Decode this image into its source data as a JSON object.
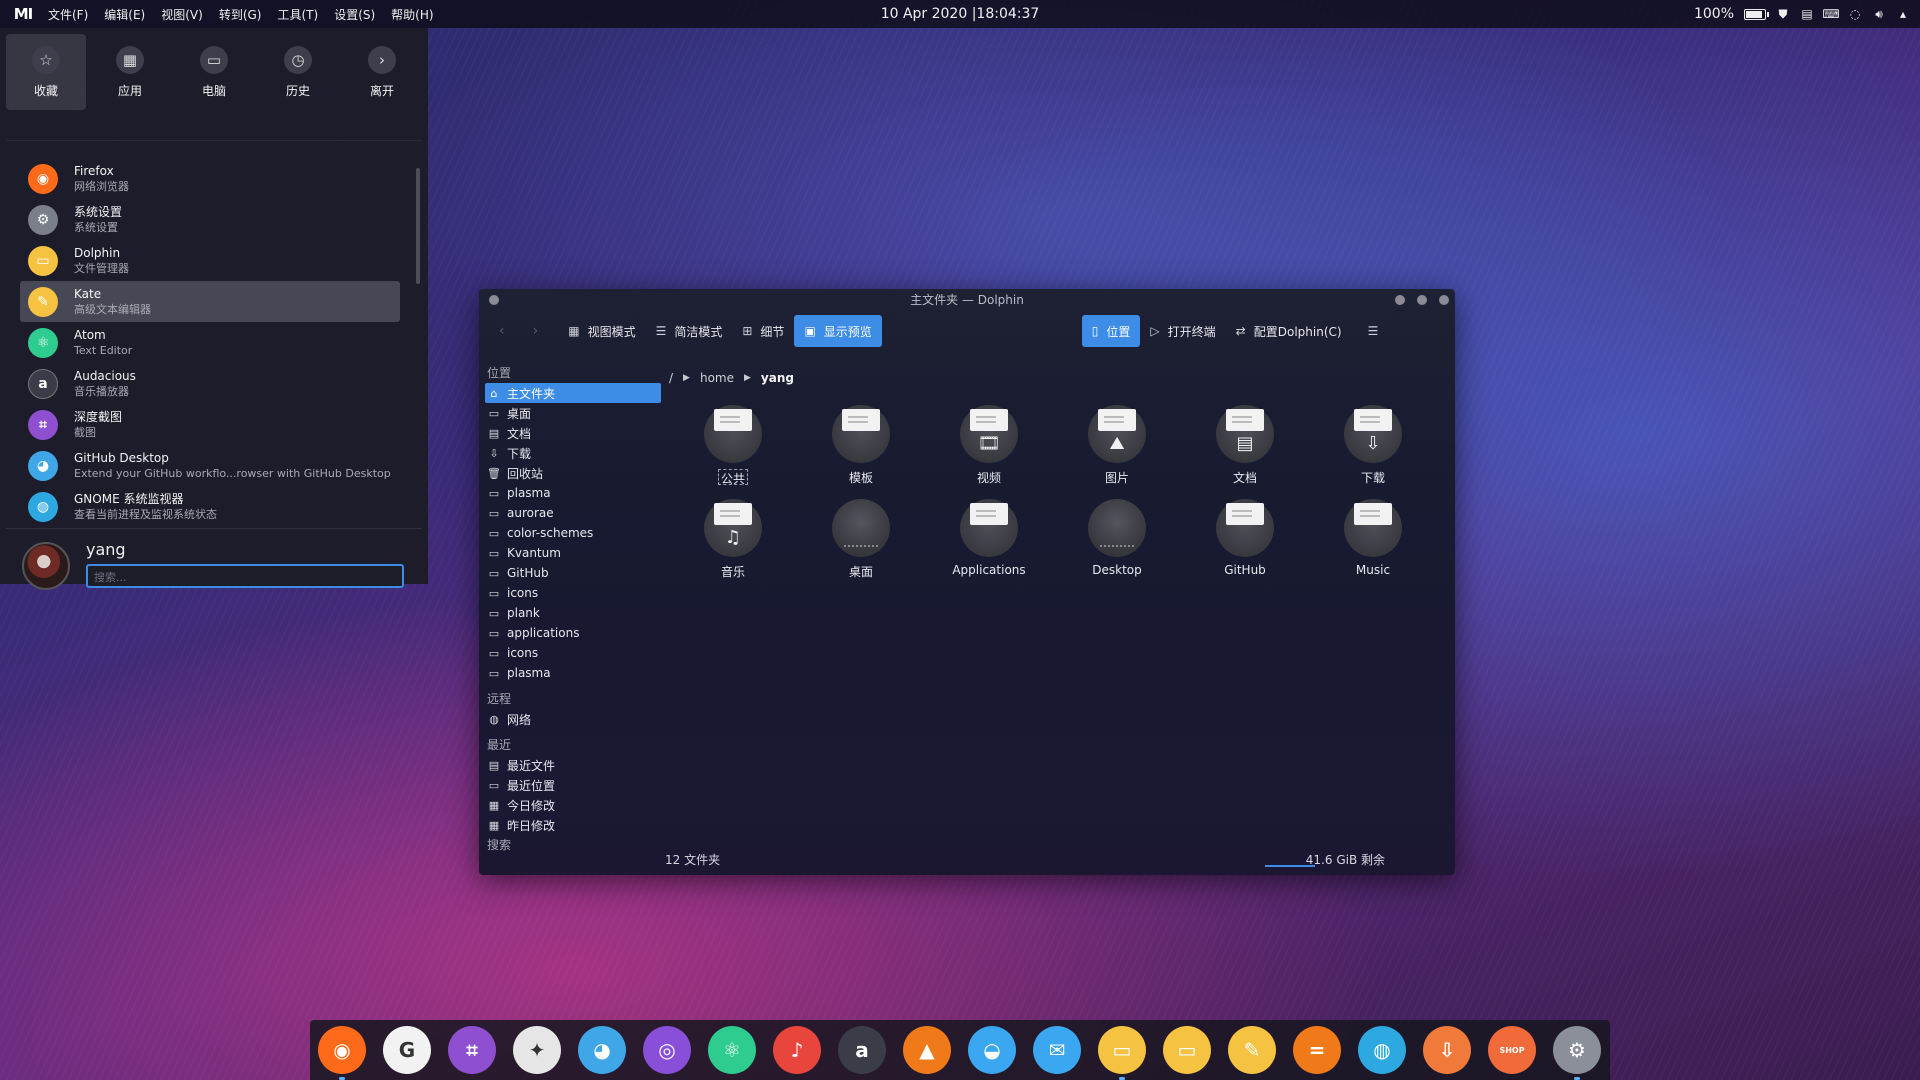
{
  "top_panel": {
    "logo": "MI",
    "menus": [
      "文件(F)",
      "编辑(E)",
      "视图(V)",
      "转到(G)",
      "工具(T)",
      "设置(S)",
      "帮助(H)"
    ],
    "clock": "10 Apr 2020 |18:04:37",
    "battery_pct": "100%",
    "tray_icons": [
      "battery-icon",
      "shield-icon",
      "clipboard-icon",
      "keyboard-icon",
      "network-icon",
      "volume-icon",
      "expand-arrow-icon"
    ]
  },
  "launcher": {
    "tabs": [
      {
        "label": "收藏",
        "icon": "star-icon"
      },
      {
        "label": "应用",
        "icon": "grid-icon"
      },
      {
        "label": "电脑",
        "icon": "monitor-icon"
      },
      {
        "label": "历史",
        "icon": "clock-icon"
      },
      {
        "label": "离开",
        "icon": "chevron-right-icon"
      }
    ],
    "apps": [
      {
        "name": "Firefox",
        "desc": "网络浏览器",
        "icon": "firefox-icon",
        "color": "#ff6a1a"
      },
      {
        "name": "系统设置",
        "desc": "系统设置",
        "icon": "settings-icon",
        "color": "#7a7f8a"
      },
      {
        "name": "Dolphin",
        "desc": "文件管理器",
        "icon": "dolphin-icon",
        "color": "#f5c242"
      },
      {
        "name": "Kate",
        "desc": "高级文本编辑器",
        "icon": "kate-icon",
        "color": "#f5c242"
      },
      {
        "name": "Atom",
        "desc": "Text Editor",
        "icon": "atom-icon",
        "color": "#2ecc8f"
      },
      {
        "name": "Audacious",
        "desc": "音乐播放器",
        "icon": "audacious-icon",
        "color": "#3a3d48"
      },
      {
        "name": "深度截图",
        "desc": "截图",
        "icon": "screenshot-icon",
        "color": "#8e4fd1"
      },
      {
        "name": "GitHub Desktop",
        "desc": "Extend your GitHub workflo...rowser with GitHub Desktop",
        "icon": "github-icon",
        "color": "#3fa6e8"
      },
      {
        "name": "GNOME 系统监视器",
        "desc": "查看当前进程及监视系统状态",
        "icon": "system-monitor-icon",
        "color": "#2ea8e0"
      }
    ],
    "user_name": "yang",
    "search_placeholder": "搜索..."
  },
  "dolphin": {
    "title": "主文件夹 — Dolphin",
    "toolbar": {
      "view_mode": "视图模式",
      "compact_mode": "简洁模式",
      "details": "细节",
      "preview": "显示预览",
      "places": "位置",
      "terminal": "打开终端",
      "configure": "配置Dolphin(C)"
    },
    "places_section": "位置",
    "places": [
      {
        "label": "主文件夹",
        "icon": "home-icon",
        "selected": true
      },
      {
        "label": "桌面",
        "icon": "desktop-icon"
      },
      {
        "label": "文档",
        "icon": "document-icon"
      },
      {
        "label": "下载",
        "icon": "download-icon"
      },
      {
        "label": "回收站",
        "icon": "trash-icon"
      },
      {
        "label": "plasma",
        "icon": "folder-icon"
      },
      {
        "label": "aurorae",
        "icon": "folder-icon"
      },
      {
        "label": "color-schemes",
        "icon": "folder-icon"
      },
      {
        "label": "Kvantum",
        "icon": "folder-icon"
      },
      {
        "label": "GitHub",
        "icon": "folder-icon"
      },
      {
        "label": "icons",
        "icon": "folder-icon"
      },
      {
        "label": "plank",
        "icon": "folder-icon"
      },
      {
        "label": "applications",
        "icon": "folder-icon"
      },
      {
        "label": "icons",
        "icon": "folder-icon"
      },
      {
        "label": "plasma",
        "icon": "folder-icon"
      }
    ],
    "remote_section": "远程",
    "remote": [
      {
        "label": "网络",
        "icon": "network-icon"
      }
    ],
    "recent_section": "最近",
    "recent": [
      {
        "label": "最近文件",
        "icon": "recent-files-icon"
      },
      {
        "label": "最近位置",
        "icon": "recent-places-icon"
      },
      {
        "label": "今日修改",
        "icon": "calendar-icon"
      },
      {
        "label": "昨日修改",
        "icon": "calendar-icon"
      }
    ],
    "search_section": "搜索",
    "breadcrumb": {
      "root": "/",
      "parts": [
        "home",
        "yang"
      ]
    },
    "items": [
      {
        "label": "公共",
        "kind": "folder",
        "glyph": ""
      },
      {
        "label": "模板",
        "kind": "folder",
        "glyph": ""
      },
      {
        "label": "视频",
        "kind": "folder",
        "glyph": "🎞"
      },
      {
        "label": "图片",
        "kind": "folder",
        "glyph": "⛰"
      },
      {
        "label": "文档",
        "kind": "folder",
        "glyph": "▤"
      },
      {
        "label": "下载",
        "kind": "folder",
        "glyph": "⇩"
      },
      {
        "label": "音乐",
        "kind": "folder",
        "glyph": "♫"
      },
      {
        "label": "桌面",
        "kind": "disc",
        "glyph": ""
      },
      {
        "label": "Applications",
        "kind": "folder",
        "glyph": ""
      },
      {
        "label": "Desktop",
        "kind": "disc",
        "glyph": ""
      },
      {
        "label": "GitHub",
        "kind": "folder",
        "glyph": ""
      },
      {
        "label": "Music",
        "kind": "folder",
        "glyph": ""
      }
    ],
    "status_count": "12 文件夹",
    "status_free": "41.6 GiB 剩余"
  },
  "dock": {
    "apps": [
      {
        "name": "firefox-icon",
        "color": "#ff6a1a",
        "glyph": "◉",
        "running": true
      },
      {
        "name": "google-chrome-icon",
        "color": "#f2f2f2",
        "glyph": "G",
        "running": false
      },
      {
        "name": "screenshot-icon",
        "color": "#8e4fd1",
        "glyph": "⌗",
        "running": false
      },
      {
        "name": "inkscape-icon",
        "color": "#e6e6e6",
        "glyph": "✦",
        "running": false
      },
      {
        "name": "github-icon",
        "color": "#3fa6e8",
        "glyph": "◕",
        "running": false
      },
      {
        "name": "camera-icon",
        "color": "#8a4fd8",
        "glyph": "◎",
        "running": false
      },
      {
        "name": "atom-icon",
        "color": "#2ecc8f",
        "glyph": "⚛",
        "running": false
      },
      {
        "name": "netease-music-icon",
        "color": "#e8453c",
        "glyph": "♪",
        "running": false
      },
      {
        "name": "audacious-icon",
        "color": "#3a3d48",
        "glyph": "a",
        "running": false
      },
      {
        "name": "vlc-icon",
        "color": "#f07a1a",
        "glyph": "▲",
        "running": false
      },
      {
        "name": "qq-icon",
        "color": "#3aa7f0",
        "glyph": "◒",
        "running": false
      },
      {
        "name": "mail-icon",
        "color": "#3aa7f0",
        "glyph": "✉",
        "running": false
      },
      {
        "name": "files-icon",
        "color": "#f5c242",
        "glyph": "▭",
        "running": true
      },
      {
        "name": "folder-icon",
        "color": "#f5c242",
        "glyph": "▭",
        "running": false
      },
      {
        "name": "kate-icon",
        "color": "#f5c242",
        "glyph": "✎",
        "running": false
      },
      {
        "name": "calculator-icon",
        "color": "#f07a1a",
        "glyph": "=",
        "running": false
      },
      {
        "name": "system-monitor-icon",
        "color": "#2ea8e0",
        "glyph": "◍",
        "running": false
      },
      {
        "name": "downloader-icon",
        "color": "#f07a3a",
        "glyph": "⇩",
        "running": false
      },
      {
        "name": "shop-icon",
        "color": "#f06a3a",
        "glyph": "SHOP",
        "running": false
      },
      {
        "name": "settings-icon",
        "color": "#8a8f9a",
        "glyph": "⚙",
        "running": true
      }
    ]
  }
}
